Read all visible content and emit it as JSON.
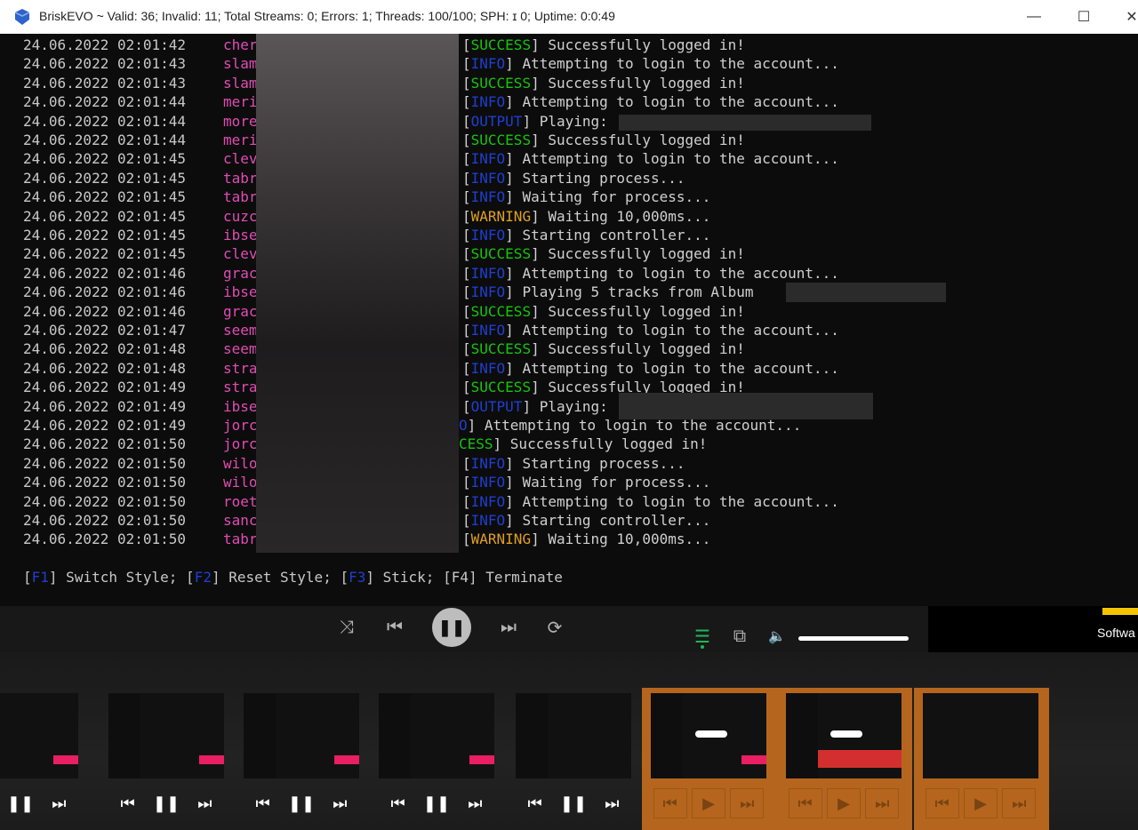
{
  "window": {
    "title": "BriskEVO ~ Valid: 36; Invalid: 11; Total Streams: 0; Errors: 1; Threads: 100/100; SPH: ɪ 0; Uptime: 0:0:49",
    "min_glyph": "—",
    "max_glyph": "☐",
    "close_glyph": "✕"
  },
  "log": [
    {
      "ts": "24.06.2022 02:01:42",
      "user": "cher",
      "tag": "SUCCESS",
      "text": " Successfully logged in!"
    },
    {
      "ts": "24.06.2022 02:01:43",
      "user": "slam",
      "tag": "INFO",
      "text": " Attempting to login to the account..."
    },
    {
      "ts": "24.06.2022 02:01:43",
      "user": "slam",
      "tag": "SUCCESS",
      "text": " Successfully logged in!"
    },
    {
      "ts": "24.06.2022 02:01:44",
      "user": "meri",
      "tag": "INFO",
      "text": " Attempting to login to the account..."
    },
    {
      "ts": "24.06.2022 02:01:44",
      "user": "more",
      "tag": "OUTPUT",
      "text": " Playing:"
    },
    {
      "ts": "24.06.2022 02:01:44",
      "user": "meri",
      "tag": "SUCCESS",
      "text": " Successfully logged in!"
    },
    {
      "ts": "24.06.2022 02:01:45",
      "user": "clev",
      "tag": "INFO",
      "text": " Attempting to login to the account..."
    },
    {
      "ts": "24.06.2022 02:01:45",
      "user": "tabr",
      "tag": "INFO",
      "text": " Starting process..."
    },
    {
      "ts": "24.06.2022 02:01:45",
      "user": "tabr",
      "tag": "INFO",
      "text": " Waiting for process..."
    },
    {
      "ts": "24.06.2022 02:01:45",
      "user": "cuzc",
      "tag": "WARNING",
      "text": " Waiting 10,000ms..."
    },
    {
      "ts": "24.06.2022 02:01:45",
      "user": "ibse",
      "tag": "INFO",
      "text": " Starting controller..."
    },
    {
      "ts": "24.06.2022 02:01:45",
      "user": "clev",
      "tag": "SUCCESS",
      "text": " Successfully logged in!"
    },
    {
      "ts": "24.06.2022 02:01:46",
      "user": "grac",
      "tag": "INFO",
      "text": " Attempting to login to the account..."
    },
    {
      "ts": "24.06.2022 02:01:46",
      "user": "ibse",
      "tag": "INFO",
      "text": " Playing 5 tracks from Album"
    },
    {
      "ts": "24.06.2022 02:01:46",
      "user": "grac",
      "tag": "SUCCESS",
      "text": " Successfully logged in!"
    },
    {
      "ts": "24.06.2022 02:01:47",
      "user": "seem",
      "tag": "INFO",
      "text": " Attempting to login to the account..."
    },
    {
      "ts": "24.06.2022 02:01:48",
      "user": "seem",
      "tag": "SUCCESS",
      "text": " Successfully logged in!"
    },
    {
      "ts": "24.06.2022 02:01:48",
      "user": "stra",
      "tag": "INFO",
      "text": " Attempting to login to the account..."
    },
    {
      "ts": "24.06.2022 02:01:49",
      "user": "stra",
      "tag": "SUCCESS",
      "text": " Successfully logged in!"
    },
    {
      "ts": "24.06.2022 02:01:49",
      "user": "ibse",
      "tag": "OUTPUT",
      "text": " Playing:"
    },
    {
      "ts": "24.06.2022 02:01:49",
      "user": "jorc",
      "tag": "",
      "text": "O] Attempting to login to the account..."
    },
    {
      "ts": "24.06.2022 02:01:50",
      "user": "jorc",
      "tag": "",
      "text": "CESS] Successfully logged in!"
    },
    {
      "ts": "24.06.2022 02:01:50",
      "user": "wilo",
      "tag": "INFO",
      "text": " Starting process..."
    },
    {
      "ts": "24.06.2022 02:01:50",
      "user": "wilo",
      "tag": "INFO",
      "text": " Waiting for process..."
    },
    {
      "ts": "24.06.2022 02:01:50",
      "user": "roet",
      "tag": "INFO",
      "text": " Attempting to login to the account..."
    },
    {
      "ts": "24.06.2022 02:01:50",
      "user": "sanc",
      "tag": "INFO",
      "text": " Starting controller..."
    },
    {
      "ts": "24.06.2022 02:01:50",
      "user": "tabr",
      "tag": "WARNING",
      "text": " Waiting 10,000ms..."
    }
  ],
  "hotkeys": [
    {
      "key": "F1",
      "label": " Switch Style; "
    },
    {
      "key": "F2",
      "label": " Reset Style; "
    },
    {
      "key": "F3",
      "label": " Stick; "
    },
    {
      "key": "F4",
      "label": " Terminate"
    }
  ],
  "player": {
    "shuffle": "⤨",
    "prev": "⏮",
    "pause": "❚❚",
    "next": "⏭",
    "repeat": "⟳",
    "queue": "☰",
    "devices": "⧉",
    "volume": "🔈",
    "volume_level": 1.0
  },
  "overlay": {
    "softwa": "Softwa"
  },
  "thumbnails": [
    {
      "active": false,
      "variant": "pink",
      "controls": [
        "⏮",
        "❚❚",
        "⏭"
      ]
    },
    {
      "active": false,
      "variant": "pink",
      "controls": [
        "⏮",
        "❚❚",
        "⏭"
      ]
    },
    {
      "active": false,
      "variant": "pink",
      "controls": [
        "⏮",
        "❚❚",
        "⏭"
      ]
    },
    {
      "active": false,
      "variant": "pink",
      "controls": [
        "⏮",
        "❚❚",
        "⏭"
      ]
    },
    {
      "active": false,
      "variant": "plain",
      "controls": [
        "⏮",
        "❚❚",
        "⏭"
      ]
    },
    {
      "active": true,
      "variant": "white",
      "controls": [
        "⏮",
        "▶",
        "⏭"
      ]
    },
    {
      "active": true,
      "variant": "red",
      "controls": [
        "⏮",
        "▶",
        "⏭"
      ]
    },
    {
      "active": true,
      "variant": "blank",
      "controls": [
        "⏮",
        "▶",
        "⏭"
      ]
    }
  ]
}
